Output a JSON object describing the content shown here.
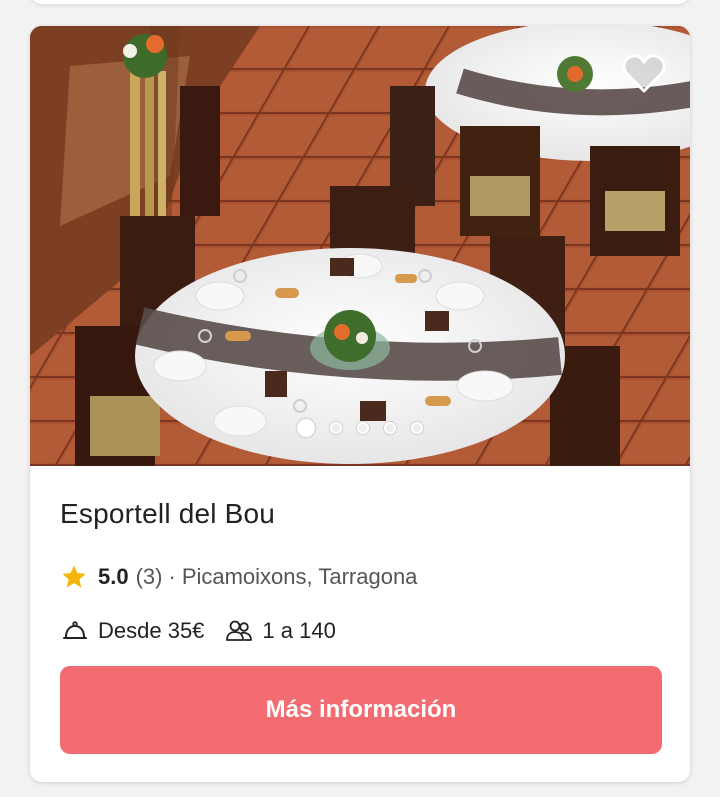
{
  "venue": {
    "title": "Esportell del Bou",
    "rating": "5.0",
    "reviews": "(3)",
    "separator": "·",
    "location": "Picamoixons, Tarragona",
    "price": "Desde 35€",
    "capacity": "1 a 140",
    "cta_label": "Más información"
  },
  "gallery": {
    "image_count": 5,
    "active_index": 0
  },
  "icons": {
    "favorite": "heart-outline-icon",
    "rating": "star-icon",
    "price": "cloche-icon",
    "capacity": "people-icon"
  },
  "colors": {
    "accent": "#f26c72",
    "star": "#f5b50a",
    "text": "#222222",
    "muted": "#555555"
  }
}
